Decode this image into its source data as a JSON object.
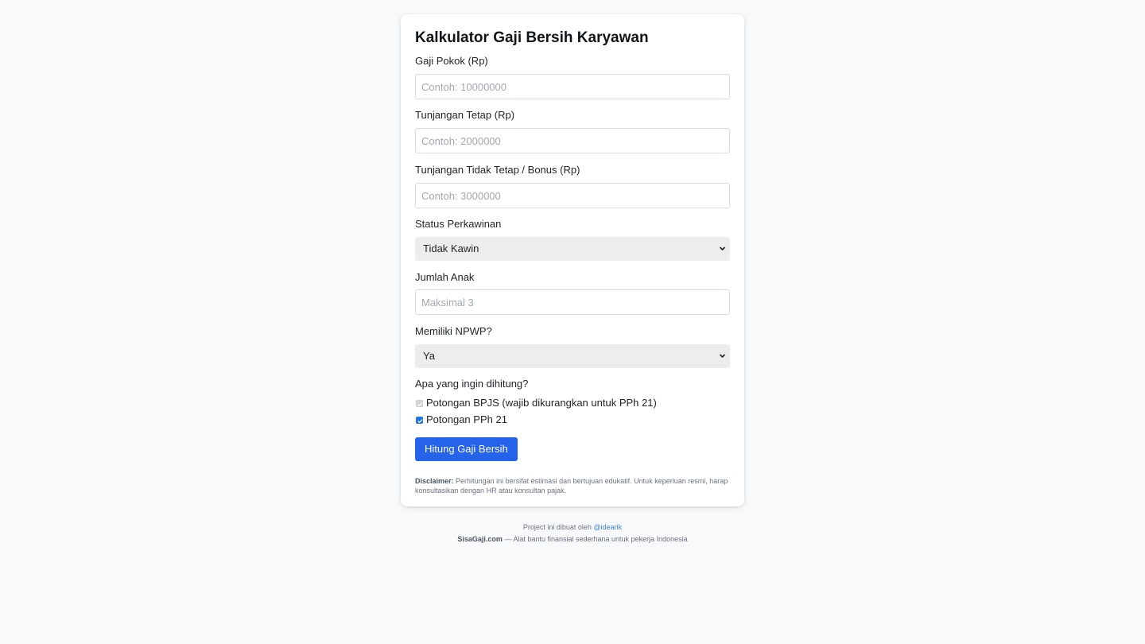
{
  "form": {
    "title": "Kalkulator Gaji Bersih Karyawan",
    "gaji_pokok": {
      "label": "Gaji Pokok (Rp)",
      "placeholder": "Contoh: 10000000",
      "value": ""
    },
    "tunjangan_tetap": {
      "label": "Tunjangan Tetap (Rp)",
      "placeholder": "Contoh: 2000000",
      "value": ""
    },
    "tunjangan_tidak_tetap": {
      "label": "Tunjangan Tidak Tetap / Bonus (Rp)",
      "placeholder": "Contoh: 3000000",
      "value": ""
    },
    "status_perkawinan": {
      "label": "Status Perkawinan",
      "selected": "Tidak Kawin"
    },
    "jumlah_anak": {
      "label": "Jumlah Anak",
      "placeholder": "Maksimal 3",
      "value": ""
    },
    "npwp": {
      "label": "Memiliki NPWP?",
      "selected": "Ya"
    },
    "hitung_section": {
      "label": "Apa yang ingin dihitung?",
      "options": [
        {
          "label": "Potongan BPJS (wajib dikurangkan untuk PPh 21)",
          "checked": true,
          "disabled": true
        },
        {
          "label": "Potongan PPh 21",
          "checked": true,
          "disabled": false
        }
      ]
    },
    "submit_label": "Hitung Gaji Bersih",
    "disclaimer": {
      "title": "Disclaimer:",
      "text": "Perhitungan ini bersifat estimasi dan bertujuan edukatif. Untuk keperluan resmi, harap konsultasikan dengan HR atau konsultan pajak."
    }
  },
  "footer": {
    "credit_prefix": "Project ini dibuat oleh",
    "credit_link": "@idearik",
    "site_name": "SisaGaji.com",
    "tagline": "— Alat bantu finansial sederhana untuk pekerja Indonesia"
  },
  "colors": {
    "accent": "#2563eb",
    "background": "#f8f9fb",
    "link": "#3b82f6"
  },
  "icons": {
    "select_chevron": "chevron-down-icon",
    "checkbox_check": "check-icon"
  }
}
